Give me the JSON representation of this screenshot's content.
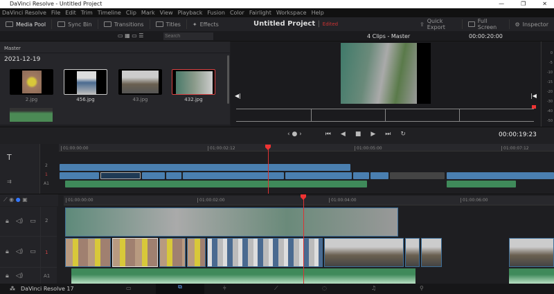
{
  "window": {
    "title": "DaVinci Resolve - Untitled Project",
    "controls": [
      "—",
      "❐",
      "✕"
    ]
  },
  "menu": [
    "DaVinci Resolve",
    "File",
    "Edit",
    "Trim",
    "Timeline",
    "Clip",
    "Mark",
    "View",
    "Playback",
    "Fusion",
    "Color",
    "Fairlight",
    "Workspace",
    "Help"
  ],
  "toolbar": {
    "media_pool": "Media Pool",
    "sync_bin": "Sync Bin",
    "transitions": "Transitions",
    "titles": "Titles",
    "effects": "Effects",
    "project": "Untitled Project",
    "status": "Edited",
    "quick_export": "Quick Export",
    "full_screen": "Full Screen",
    "inspector": "Inspector"
  },
  "subbar": {
    "search_placeholder": "Search",
    "viewer_title": "4 Clips - Master",
    "timecode": "00:00:20:00"
  },
  "pool": {
    "bin": "Master",
    "date": "2021-12-19",
    "clips": [
      {
        "name": "2.jpg"
      },
      {
        "name": "456.jpg"
      },
      {
        "name": "43.jpg"
      },
      {
        "name": "432.jpg"
      }
    ]
  },
  "meters": [
    "0",
    "-5",
    "-10",
    "-15",
    "-20",
    "-30",
    "-40",
    "-50"
  ],
  "transport": {
    "timecode": "00:00:19:23"
  },
  "upper_ruler": [
    "01:00:00:00",
    "01:00:02:12",
    "01:00:05:00",
    "01:00:07:12"
  ],
  "lower_ruler": [
    "01:00:00:00",
    "01:00:02:00",
    "01:00:04:00",
    "01:00:06:00"
  ],
  "tracks": {
    "v2": "2",
    "v1": "1",
    "a1": "A1"
  },
  "footer": {
    "app": "DaVinci Resolve 17"
  },
  "colors": {
    "accent": "#e33",
    "video_clip": "#4a7fb0",
    "audio_clip": "#3f8a5a"
  }
}
